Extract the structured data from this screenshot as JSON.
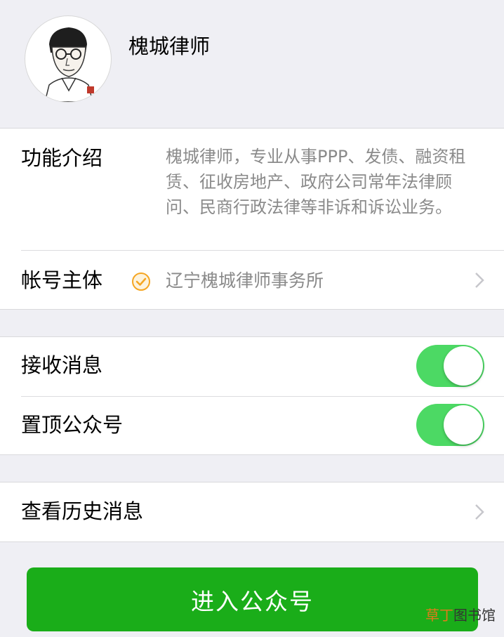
{
  "header": {
    "account_name": "槐城律师"
  },
  "info": {
    "intro_label": "功能介绍",
    "intro_text": "槐城律师，专业从事PPP、发债、融资租赁、征收房地产、政府公司常年法律顾问、民商行政法律等非诉和诉讼业务。",
    "owner_label": "帐号主体",
    "owner_name": "辽宁槐城律师事务所"
  },
  "settings": {
    "receive_label": "接收消息",
    "receive_on": true,
    "pin_label": "置顶公众号",
    "pin_on": true
  },
  "history": {
    "label": "查看历史消息"
  },
  "enter_button": "进入公众号",
  "watermark": {
    "part1": "草丁",
    "part2": "图书馆"
  },
  "colors": {
    "toggle_on": "#4cd964",
    "button": "#1aad19",
    "verify": "#f5a623"
  }
}
